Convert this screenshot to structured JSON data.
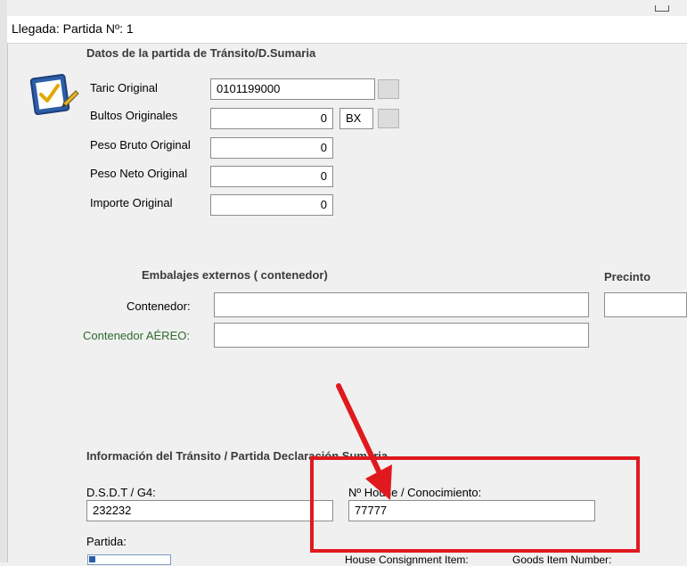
{
  "window": {
    "title": "Llegada: Partida Nº: 1"
  },
  "transit": {
    "heading": "Datos de la partida de Tránsito/D.Sumaria",
    "taric": {
      "label": "Taric Original",
      "value": "0101199000"
    },
    "bultos": {
      "label": "Bultos Originales",
      "value": "0",
      "unit": "BX"
    },
    "peso_bruto": {
      "label": "Peso Bruto Original",
      "value": "0"
    },
    "peso_neto": {
      "label": "Peso Neto Original",
      "value": "0"
    },
    "importe": {
      "label": "Importe Original",
      "value": "0"
    }
  },
  "packaging": {
    "heading": "Embalajes externos ( contenedor)",
    "precinto_heading": "Precinto",
    "contenedor_label": "Contenedor:",
    "contenedor_value": "",
    "aereo_label": "Contenedor AÉREO:",
    "aereo_value": "",
    "precinto_value": ""
  },
  "info": {
    "heading": "Información del Tránsito / Partida Declaración Sumaria",
    "dsdt": {
      "label": "D.S.D.T / G4:",
      "value": "232232"
    },
    "house": {
      "label": "Nº House / Conocimiento:",
      "value": "77777"
    },
    "partida_label": "Partida:",
    "consignment_label": "House Consignment Item:",
    "goods_label": "Goods Item Number:"
  },
  "colors": {
    "annotation": "#e0191f",
    "green_label": "#2e6b2e"
  },
  "icons": {
    "form": "clipboard-check-icon",
    "arrow": "annotation-arrow"
  }
}
